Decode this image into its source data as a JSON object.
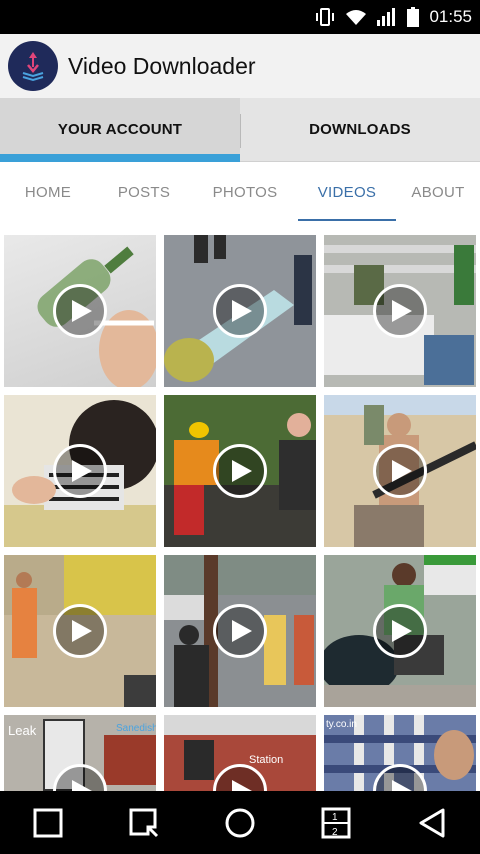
{
  "status_bar": {
    "time": "01:55",
    "icons": [
      "vibrate-icon",
      "wifi-icon",
      "signal-icon",
      "battery-icon"
    ]
  },
  "app_bar": {
    "title": "Video Downloader",
    "logo_icon": "download-logo-icon"
  },
  "main_tabs": [
    {
      "label": "YOUR ACCOUNT",
      "active": true
    },
    {
      "label": "DOWNLOADS",
      "active": false
    }
  ],
  "sub_tabs": [
    {
      "label": "HOME",
      "active": false
    },
    {
      "label": "POSTS",
      "active": false
    },
    {
      "label": "PHOTOS",
      "active": false
    },
    {
      "label": "VIDEOS",
      "active": true
    },
    {
      "label": "ABOUT",
      "active": false
    }
  ],
  "videos": [
    {
      "name": "video-thumb-bottle",
      "play_icon": "play-icon"
    },
    {
      "name": "video-thumb-street",
      "play_icon": "play-icon"
    },
    {
      "name": "video-thumb-store",
      "play_icon": "play-icon"
    },
    {
      "name": "video-thumb-baby",
      "play_icon": "play-icon"
    },
    {
      "name": "video-thumb-workers",
      "play_icon": "play-icon"
    },
    {
      "name": "video-thumb-gun",
      "play_icon": "play-icon"
    },
    {
      "name": "video-thumb-alley",
      "play_icon": "play-icon"
    },
    {
      "name": "video-thumb-crowd",
      "play_icon": "play-icon"
    },
    {
      "name": "video-thumb-car",
      "play_icon": "play-icon"
    },
    {
      "name": "video-thumb-leak",
      "play_icon": "play-icon"
    },
    {
      "name": "video-thumb-bus",
      "play_icon": "play-icon"
    },
    {
      "name": "video-thumb-shirt",
      "play_icon": "play-icon"
    }
  ],
  "nav_bar": [
    "square-icon",
    "search-square-icon",
    "home-circle-icon",
    "multi-window-icon",
    "back-triangle-icon"
  ],
  "thumb_text": {
    "leak": "Leak",
    "leak2": "Sanedisha",
    "bus": "Station",
    "shirt": "ty.co.in"
  },
  "colors": {
    "accent": "#3aa0d8",
    "active_subtab": "#3a6fa8",
    "logo_bg": "#1f2a5a"
  }
}
